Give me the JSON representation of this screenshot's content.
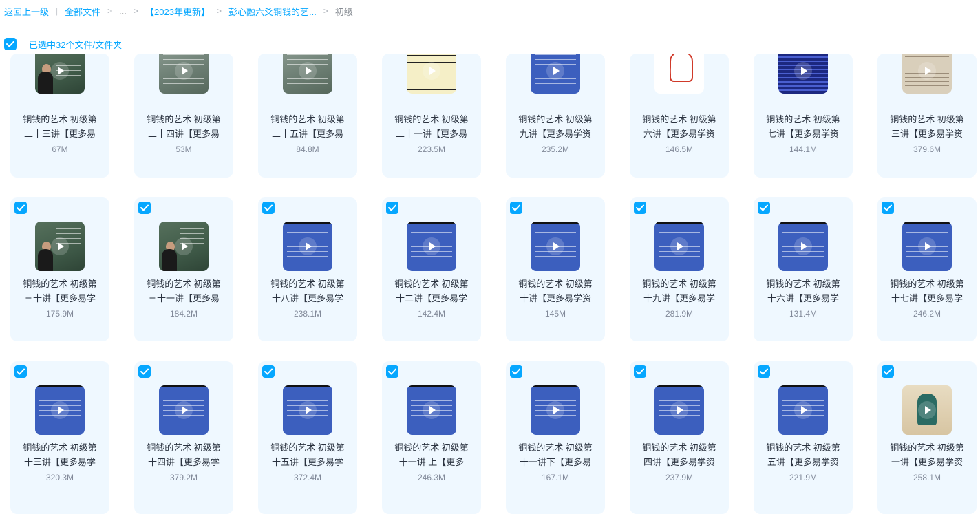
{
  "breadcrumb": {
    "back": "返回上一级",
    "all_files": "全部文件",
    "ellipsis": "...",
    "folder_2023": "【2023年更新】",
    "folder_course": "彭心融六爻铜钱的艺...",
    "current": "初级"
  },
  "selection": {
    "label": "已选中32个文件/文件夹",
    "checked": true
  },
  "colors": {
    "accent": "#06a7ff",
    "card_bg": "#eff8ff",
    "text": "#2b3340",
    "muted": "#818999"
  },
  "icons": {
    "check": "check-icon",
    "play": "play-icon"
  },
  "files": [
    {
      "line1": "铜钱的艺术 初级第",
      "line2": "二十三讲【更多易",
      "size": "67M",
      "thumb": "board"
    },
    {
      "line1": "铜钱的艺术 初级第",
      "line2": "二十四讲【更多易",
      "size": "53M",
      "thumb": "board2"
    },
    {
      "line1": "铜钱的艺术 初级第",
      "line2": "二十五讲【更多易",
      "size": "84.8M",
      "thumb": "board2"
    },
    {
      "line1": "铜钱的艺术 初级第",
      "line2": "二十一讲【更多易",
      "size": "223.5M",
      "thumb": "chart"
    },
    {
      "line1": "铜钱的艺术 初级第",
      "line2": "九讲【更多易学资",
      "size": "235.2M",
      "thumb": "blue"
    },
    {
      "line1": "铜钱的艺术 初级第",
      "line2": "六讲【更多易学资",
      "size": "146.5M",
      "thumb": "hand"
    },
    {
      "line1": "铜钱的艺术 初级第",
      "line2": "七讲【更多易学资",
      "size": "144.1M",
      "thumb": "grid"
    },
    {
      "line1": "铜钱的艺术 初级第",
      "line2": "三讲【更多易学资",
      "size": "379.6M",
      "thumb": "paper"
    },
    {
      "line1": "铜钱的艺术 初级第",
      "line2": "三十讲【更多易学",
      "size": "175.9M",
      "thumb": "board"
    },
    {
      "line1": "铜钱的艺术 初级第",
      "line2": "三十一讲【更多易",
      "size": "184.2M",
      "thumb": "board"
    },
    {
      "line1": "铜钱的艺术 初级第",
      "line2": "十八讲【更多易学",
      "size": "238.1M",
      "thumb": "blue"
    },
    {
      "line1": "铜钱的艺术 初级第",
      "line2": "十二讲【更多易学",
      "size": "142.4M",
      "thumb": "blue"
    },
    {
      "line1": "铜钱的艺术 初级第",
      "line2": "十讲【更多易学资",
      "size": "145M",
      "thumb": "blue"
    },
    {
      "line1": "铜钱的艺术 初级第",
      "line2": "十九讲【更多易学",
      "size": "281.9M",
      "thumb": "blue"
    },
    {
      "line1": "铜钱的艺术 初级第",
      "line2": "十六讲【更多易学",
      "size": "131.4M",
      "thumb": "blue"
    },
    {
      "line1": "铜钱的艺术 初级第",
      "line2": "十七讲【更多易学",
      "size": "246.2M",
      "thumb": "blue"
    },
    {
      "line1": "铜钱的艺术 初级第",
      "line2": "十三讲【更多易学",
      "size": "320.3M",
      "thumb": "blue"
    },
    {
      "line1": "铜钱的艺术 初级第",
      "line2": "十四讲【更多易学",
      "size": "379.2M",
      "thumb": "blue"
    },
    {
      "line1": "铜钱的艺术 初级第",
      "line2": "十五讲【更多易学",
      "size": "372.4M",
      "thumb": "blue"
    },
    {
      "line1": "铜钱的艺术 初级第",
      "line2": "十一讲 上【更多",
      "size": "246.3M",
      "thumb": "blue"
    },
    {
      "line1": "铜钱的艺术 初级第",
      "line2": "十一讲下【更多易",
      "size": "167.1M",
      "thumb": "blue"
    },
    {
      "line1": "铜钱的艺术 初级第",
      "line2": "四讲【更多易学资",
      "size": "237.9M",
      "thumb": "blue"
    },
    {
      "line1": "铜钱的艺术 初级第",
      "line2": "五讲【更多易学资",
      "size": "221.9M",
      "thumb": "blue"
    },
    {
      "line1": "铜钱的艺术 初级第",
      "line2": "一讲【更多易学资",
      "size": "258.1M",
      "thumb": "portrait"
    }
  ]
}
